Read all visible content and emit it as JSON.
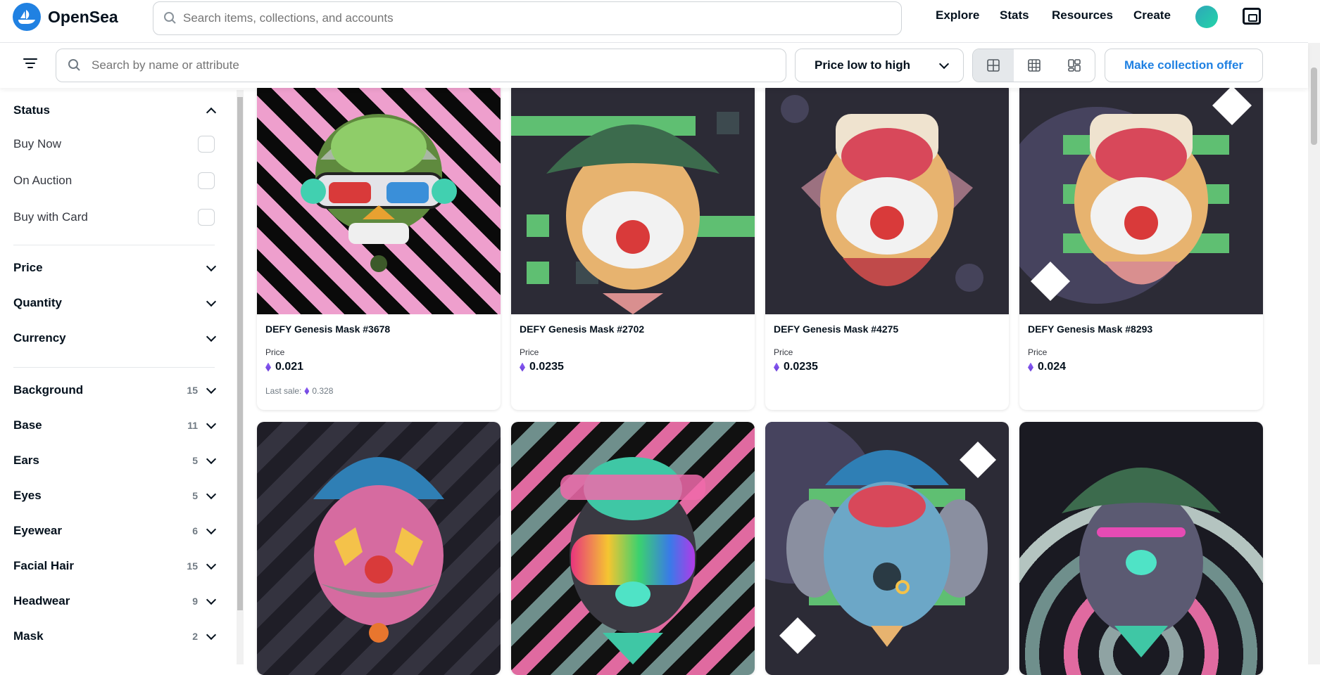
{
  "header": {
    "brand": "OpenSea",
    "search_placeholder": "Search items, collections, and accounts",
    "nav": [
      "Explore",
      "Stats",
      "Resources",
      "Create"
    ]
  },
  "toolbar": {
    "filter_placeholder": "Search by name or attribute",
    "sort_label": "Price low to high",
    "offer_label": "Make collection offer"
  },
  "sidebar": {
    "status_title": "Status",
    "status_options": [
      "Buy Now",
      "On Auction",
      "Buy with Card"
    ],
    "simple_filters": [
      "Price",
      "Quantity",
      "Currency"
    ],
    "trait_filters": [
      {
        "name": "Background",
        "count": "15"
      },
      {
        "name": "Base",
        "count": "11"
      },
      {
        "name": "Ears",
        "count": "5"
      },
      {
        "name": "Eyes",
        "count": "5"
      },
      {
        "name": "Eyewear",
        "count": "6"
      },
      {
        "name": "Facial Hair",
        "count": "15"
      },
      {
        "name": "Headwear",
        "count": "9"
      },
      {
        "name": "Mask",
        "count": "2"
      }
    ]
  },
  "items": [
    {
      "name": "DEFY Genesis Mask #3678",
      "price_label": "Price",
      "price": "0.021",
      "last_sale_label": "Last sale:",
      "last_sale": "0.328"
    },
    {
      "name": "DEFY Genesis Mask #2702",
      "price_label": "Price",
      "price": "0.0235"
    },
    {
      "name": "DEFY Genesis Mask #4275",
      "price_label": "Price",
      "price": "0.0235"
    },
    {
      "name": "DEFY Genesis Mask #8293",
      "price_label": "Price",
      "price": "0.024"
    }
  ],
  "colors": {
    "accent": "#2081e2",
    "text": "#04111d",
    "border": "#e5e8eb"
  },
  "icons": [
    "opensea-logo-icon",
    "search-icon",
    "avatar",
    "wallet-icon",
    "filter-icon",
    "chevron-down-icon",
    "chevron-up-icon",
    "grid-large-icon",
    "grid-small-icon",
    "grid-mosaic-icon",
    "ethereum-icon"
  ]
}
